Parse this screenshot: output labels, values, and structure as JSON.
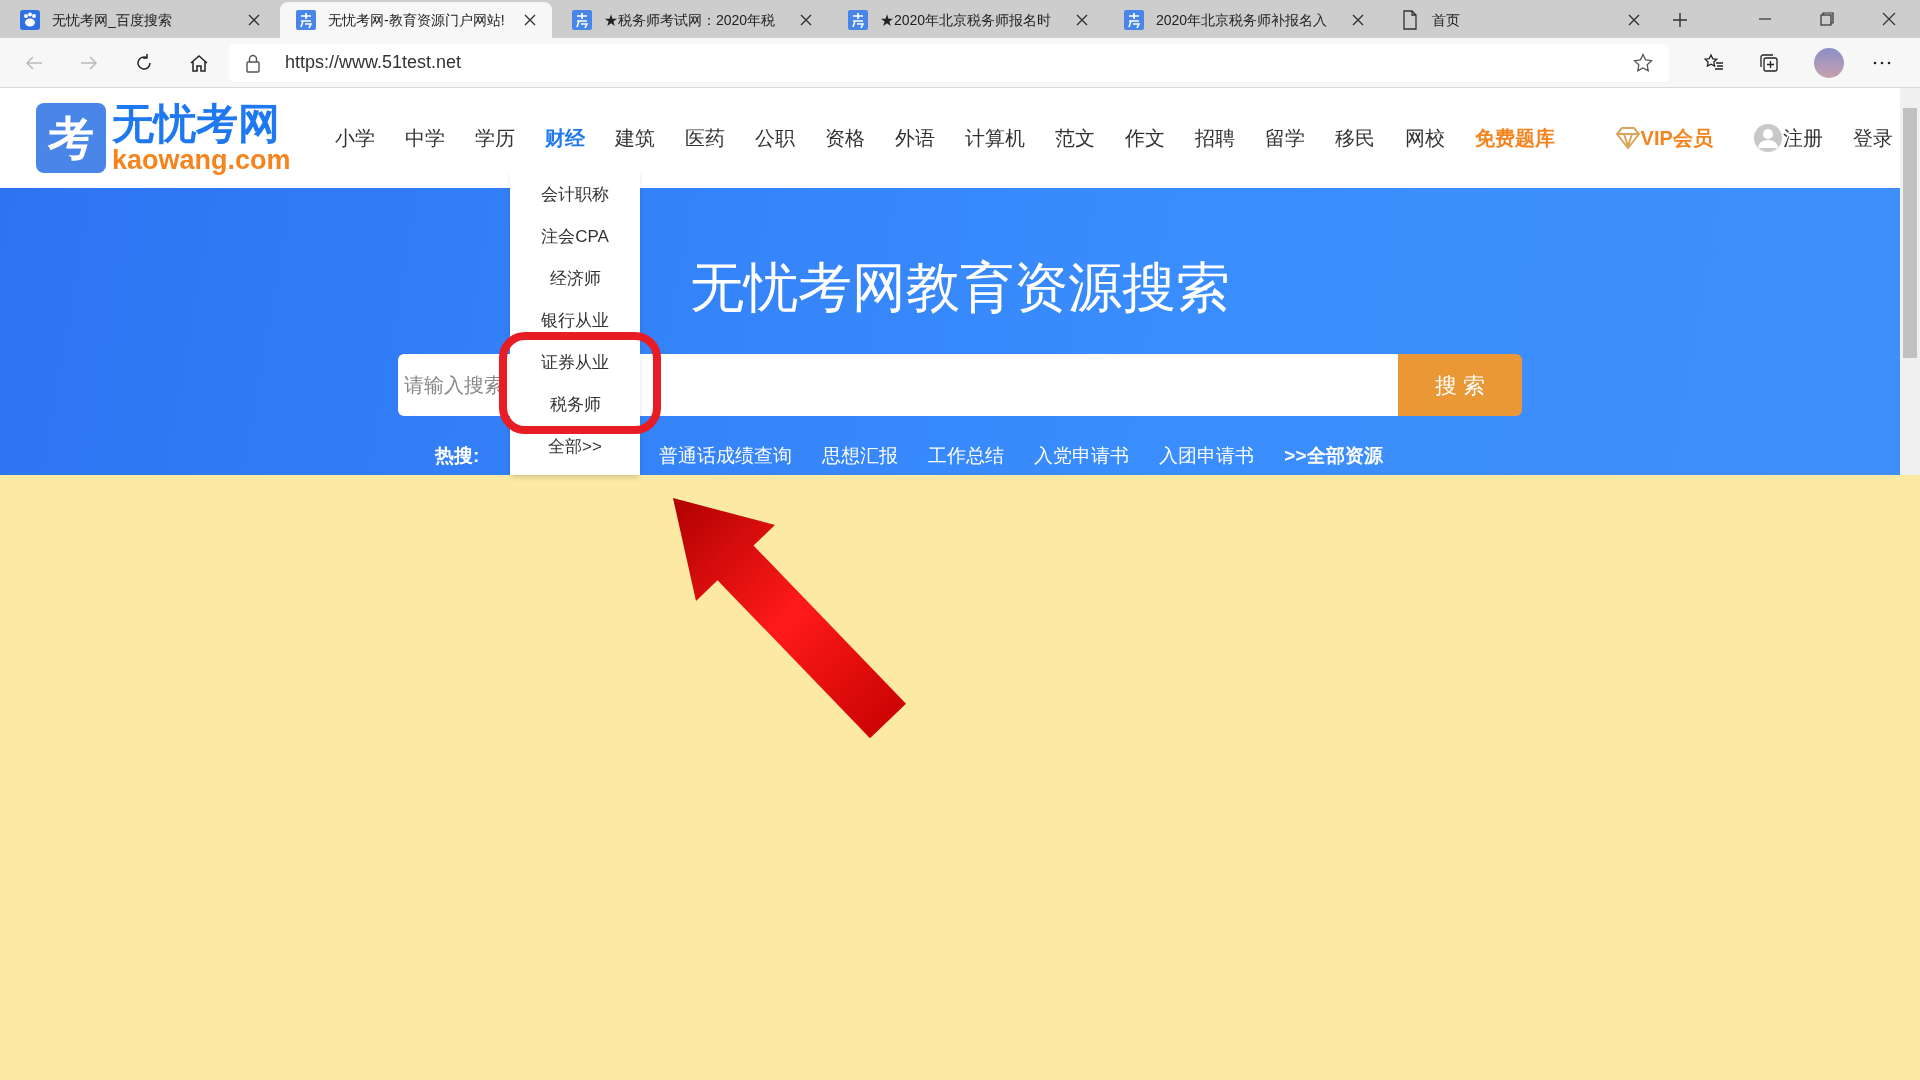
{
  "browser": {
    "tabs": [
      {
        "title": "无忧考网_百度搜索",
        "kind": "paw",
        "selected": false
      },
      {
        "title": "无忧考网-教育资源门户网站!",
        "kind": "site",
        "selected": true
      },
      {
        "title": "★税务师考试网：2020年税",
        "kind": "site",
        "selected": false
      },
      {
        "title": "★2020年北京税务师报名时",
        "kind": "site",
        "selected": false
      },
      {
        "title": "2020年北京税务师补报名入",
        "kind": "site",
        "selected": false
      },
      {
        "title": "首页",
        "kind": "page",
        "selected": false
      }
    ],
    "url": "https://www.51test.net"
  },
  "site": {
    "logo": {
      "mark": "考",
      "name": "无忧考网",
      "domain": "kaowang.com"
    },
    "nav": [
      {
        "label": "小学",
        "selected": false
      },
      {
        "label": "中学",
        "selected": false
      },
      {
        "label": "学历",
        "selected": false
      },
      {
        "label": "财经",
        "selected": true
      },
      {
        "label": "建筑",
        "selected": false
      },
      {
        "label": "医药",
        "selected": false
      },
      {
        "label": "公职",
        "selected": false
      },
      {
        "label": "资格",
        "selected": false
      },
      {
        "label": "外语",
        "selected": false
      },
      {
        "label": "计算机",
        "selected": false
      },
      {
        "label": "范文",
        "selected": false
      },
      {
        "label": "作文",
        "selected": false
      },
      {
        "label": "招聘",
        "selected": false
      },
      {
        "label": "留学",
        "selected": false
      },
      {
        "label": "移民",
        "selected": false
      },
      {
        "label": "网校",
        "selected": false
      }
    ],
    "free_bank": "免费题库",
    "vip": "VIP会员",
    "register": "注册",
    "login": "登录",
    "dropdown": [
      "会计职称",
      "注会CPA",
      "经济师",
      "银行从业",
      "证券从业",
      "税务师",
      "全部>>"
    ],
    "banner": {
      "title": "无忧考网教育资源搜索",
      "search": {
        "placeholder": "请输入搜索",
        "button": "搜 索"
      },
      "hot": {
        "label": "热搜:",
        "links": [
          "普通话成绩查询",
          "思想汇报",
          "工作总结",
          "入党申请书",
          "入团申请书"
        ],
        "all": ">>全部资源"
      }
    }
  }
}
